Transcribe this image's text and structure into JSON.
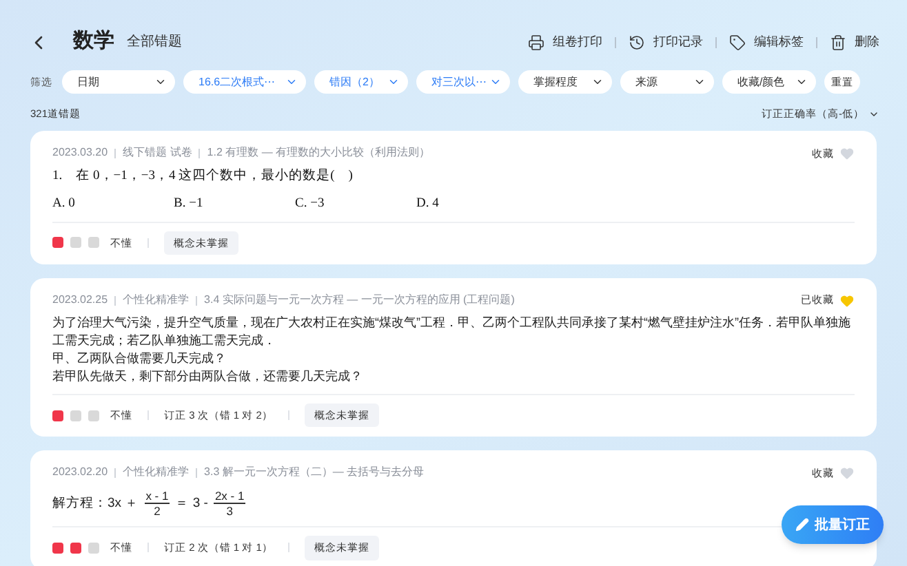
{
  "header": {
    "title": "数学",
    "subtitle": "全部错题",
    "actions": [
      {
        "kind": "print",
        "label": "组卷打印"
      },
      {
        "kind": "history",
        "label": "打印记录"
      },
      {
        "kind": "tag",
        "label": "编辑标签"
      },
      {
        "kind": "delete",
        "label": "删除"
      }
    ]
  },
  "filter_label": "筛选",
  "filters": [
    {
      "label": "日期",
      "active": false
    },
    {
      "label": "16.6二次根式⋯",
      "active": true
    },
    {
      "label": "错因（2）",
      "active": true
    },
    {
      "label": "对三次以⋯",
      "active": true
    },
    {
      "label": "掌握程度",
      "active": false
    },
    {
      "label": "来源",
      "active": false
    },
    {
      "label": "收藏/颜色",
      "active": false
    }
  ],
  "reset_button": "重置",
  "count": "321道错题",
  "sort": "订正正确率（高-低）",
  "cards": [
    {
      "date": "2023.03.20",
      "source": "线下错题 试卷",
      "topic": "1.2 有理数 — 有理数的大小比较（利用法则）",
      "favorite_label": "收藏",
      "favorited": false,
      "kind": "choice",
      "question": "1.　在 0，−1，−3，4 这四个数中，最小的数是(　)",
      "options": [
        "A. 0",
        "B.  −1",
        "C.  −3",
        "D. 4"
      ],
      "marks": [
        {
          "color": "#f0364a"
        },
        {
          "color": "#d9d9d9"
        },
        {
          "color": "#d9d9d9"
        }
      ],
      "level_label": "不懂",
      "reason": "概念未掌握"
    },
    {
      "date": "2023.02.25",
      "source": "个性化精准学",
      "topic": "3.4 实际问题与一元一次方程 — 一元一次方程的应用 (工程问题)",
      "favorite_label": "已收藏",
      "favorited": true,
      "kind": "text",
      "lines": [
        "为了治理大气污染，提升空气质量，现在广大农村正在实施“煤改气”工程．甲、乙两个工程队共同承接了某村“燃气壁挂炉注水”任务．若甲队单独施工需天完成；若乙队单独施工需天完成．",
        "甲、乙两队合做需要几天完成？",
        "若甲队先做天，剩下部分由两队合做，还需要几天完成？"
      ],
      "marks": [
        {
          "color": "#f0364a"
        },
        {
          "color": "#d9d9d9"
        },
        {
          "color": "#d9d9d9"
        }
      ],
      "level_label": "不懂",
      "correction": "订正 3 次（错 1 对 2）",
      "reason": "概念未掌握"
    },
    {
      "date": "2023.02.20",
      "source": "个性化精准学",
      "topic": "3.3 解一元一次方程（二）— 去括号与去分母",
      "favorite_label": "收藏",
      "favorited": false,
      "kind": "equation",
      "parts": [
        {
          "kind": "text",
          "text": "解方程：3x ＋"
        },
        {
          "kind": "frac",
          "num": "x - 1",
          "den": "2"
        },
        {
          "kind": "text",
          "text": "＝ 3 -"
        },
        {
          "kind": "frac",
          "num": "2x - 1",
          "den": "3"
        }
      ],
      "marks": [
        {
          "color": "#f0364a"
        },
        {
          "color": "#f0364a"
        },
        {
          "color": "#d9d9d9"
        }
      ],
      "level_label": "不懂",
      "correction": "订正 2 次（错 1 对 1）",
      "reason": "概念未掌握"
    }
  ],
  "fab": "批量订正"
}
